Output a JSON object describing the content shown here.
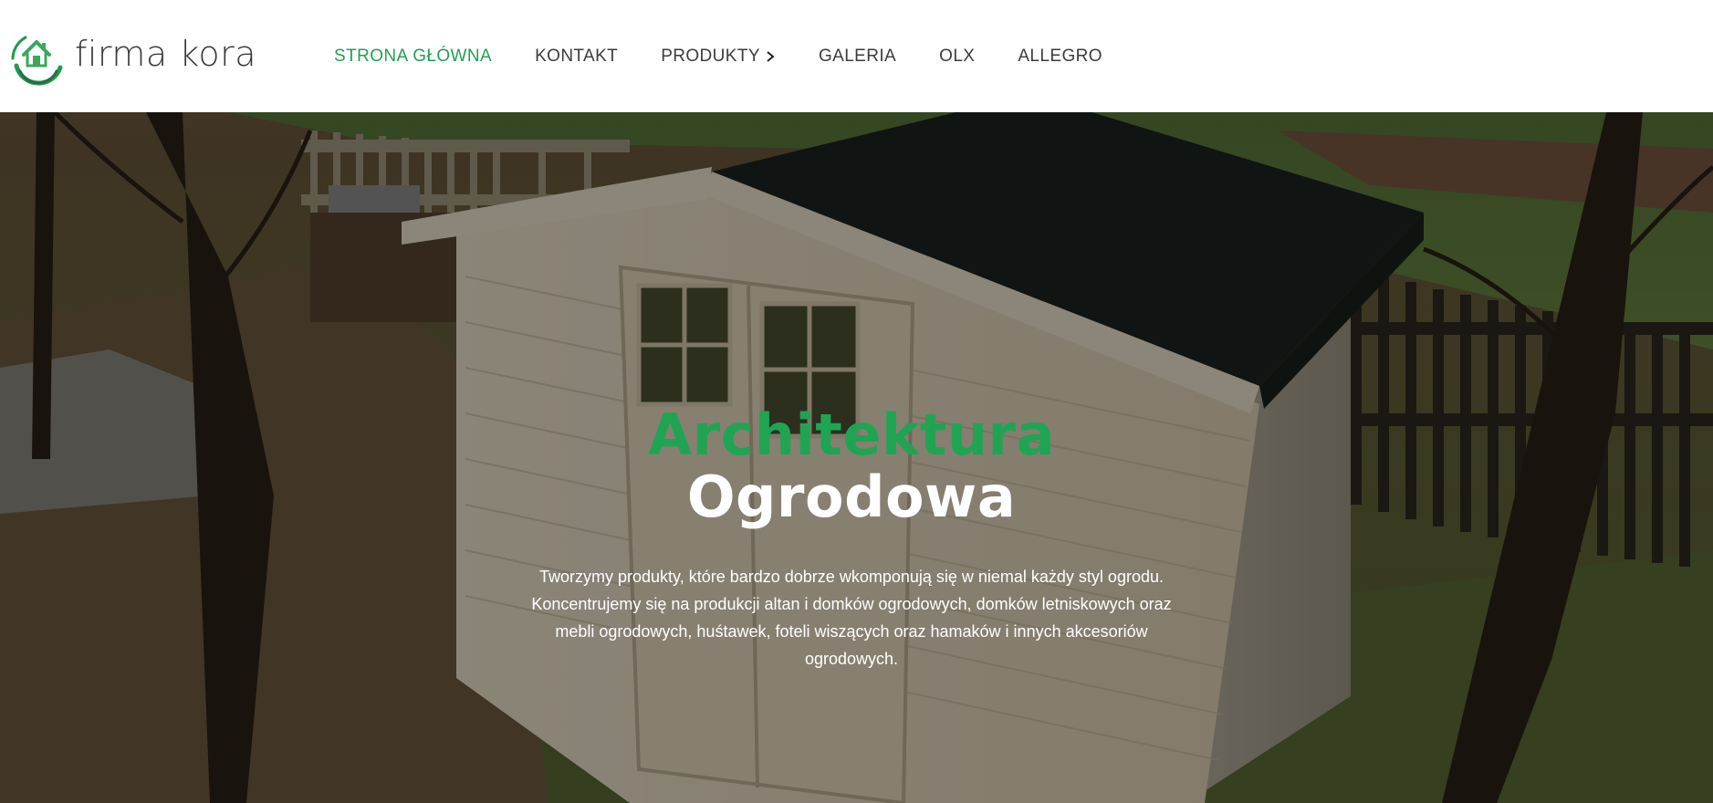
{
  "theme": {
    "accent": "#20a152",
    "nav_text": "#3c3c3c",
    "hero_title_accent": "#1fa454",
    "hero_title_main": "#ffffff",
    "hero_text": "#ffffff"
  },
  "brand": {
    "name": "firma kora",
    "logo_icon": "house-icon"
  },
  "nav": {
    "items": [
      {
        "label": "STRONA GŁÓWNA",
        "active": true
      },
      {
        "label": "KONTAKT",
        "active": false
      },
      {
        "label": "PRODUKTY",
        "active": false,
        "icon": "chevron-right-icon"
      },
      {
        "label": "GALERIA",
        "active": false
      },
      {
        "label": "OLX",
        "active": false
      },
      {
        "label": "ALLEGRO",
        "active": false
      }
    ]
  },
  "hero": {
    "title_line1": "Architektura",
    "title_line2": "Ogrodowa",
    "description": "Tworzymy produkty, które bardzo dobrze wkomponują się w niemal każdy styl ogrodu. Koncentrujemy się na produkcji altan i domków ogrodowych, domków letniskowych oraz mebli ogrodowych, huśtawek, foteli wiszących oraz hamaków i innych akcesoriów ogrodowych.",
    "background": "garden-shed-photo"
  }
}
